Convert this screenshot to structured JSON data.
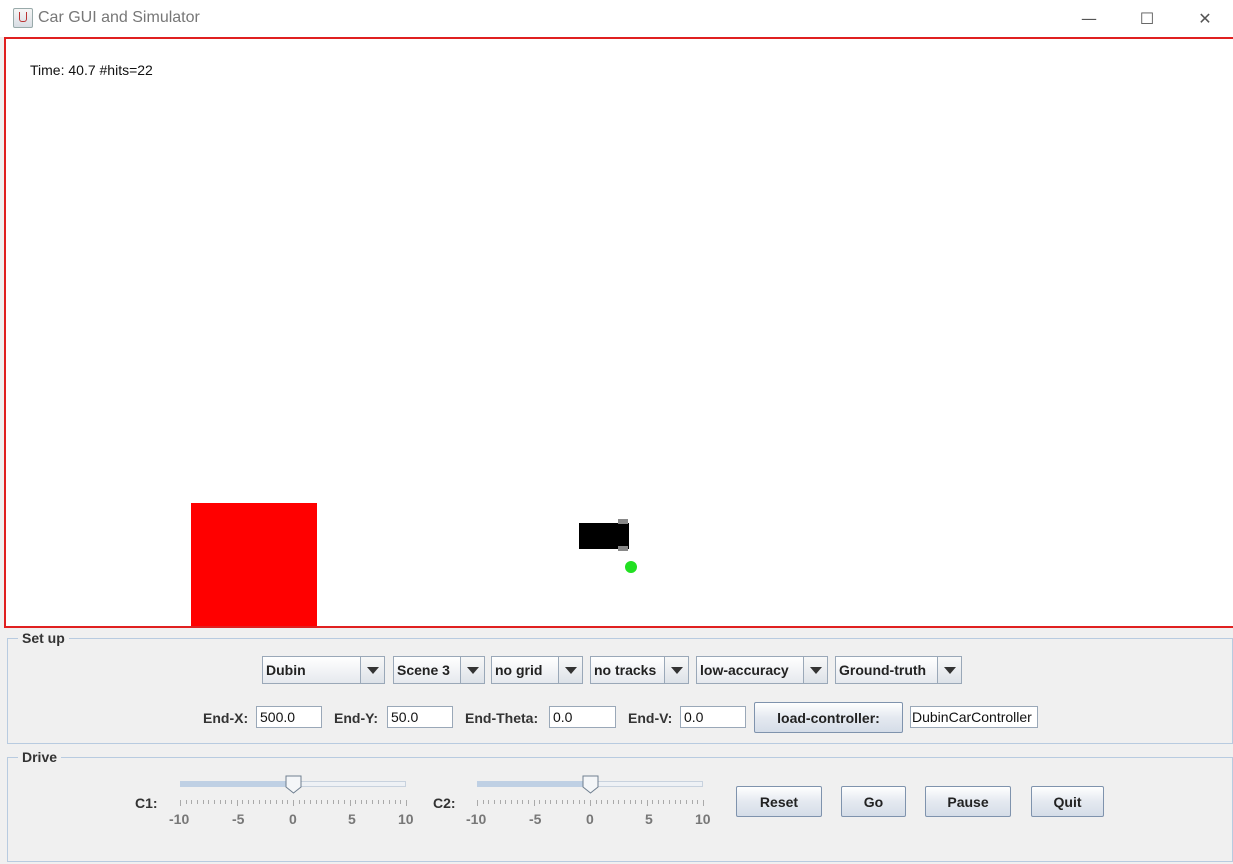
{
  "window": {
    "title": "Car GUI and Simulator",
    "icon": "java-cup-icon"
  },
  "window_controls": {
    "minimize": "—",
    "maximize": "☐",
    "close": "✕"
  },
  "canvas": {
    "status": "Time: 40.7  #hits=22"
  },
  "setup": {
    "legend": "Set up",
    "combos": [
      {
        "value": "Dubin"
      },
      {
        "value": "Scene 3"
      },
      {
        "value": "no grid"
      },
      {
        "value": "no tracks"
      },
      {
        "value": "low-accuracy"
      },
      {
        "value": "Ground-truth"
      }
    ],
    "fields": {
      "end_x": {
        "label": "End-X:",
        "value": "500.0"
      },
      "end_y": {
        "label": "End-Y:",
        "value": "50.0"
      },
      "end_theta": {
        "label": "End-Theta:",
        "value": "0.0"
      },
      "end_v": {
        "label": "End-V:",
        "value": "0.0"
      }
    },
    "load_controller_label": "load-controller:",
    "controller_value": "DubinCarController"
  },
  "drive": {
    "legend": "Drive",
    "c1": {
      "label": "C1:",
      "value": 0,
      "min": -10,
      "max": 10
    },
    "c2": {
      "label": "C2:",
      "value": 0,
      "min": -10,
      "max": 10
    },
    "tick_labels": [
      "-10",
      "-5",
      "0",
      "5",
      "10"
    ],
    "buttons": {
      "reset": "Reset",
      "go": "Go",
      "pause": "Pause",
      "quit": "Quit"
    }
  },
  "colors": {
    "canvas_border": "#e02020",
    "obstacle": "#ff0000",
    "car": "#000000",
    "target": "#22e022"
  }
}
